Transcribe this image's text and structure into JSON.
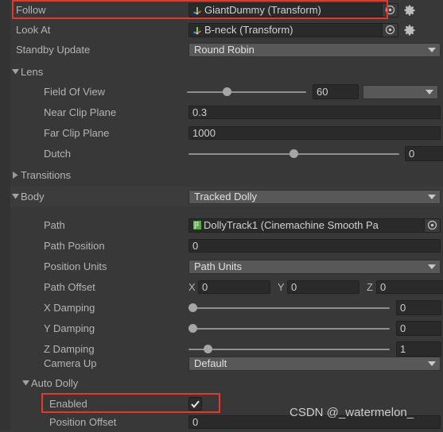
{
  "theme": {
    "bg": "#383838",
    "row_shade": "#3c3c3c",
    "field_bg": "#2a2a2a",
    "dropdown_bg": "#585858",
    "text": "#b4b4b4",
    "highlight": "#e8362a"
  },
  "rows": {
    "follow": {
      "label": "Follow",
      "value": "GiantDummy (Transform)",
      "icon": "transform-axis-icon",
      "picker": "object-picker-icon",
      "gear": "gear-icon"
    },
    "look_at": {
      "label": "Look At",
      "value": "B-neck (Transform)",
      "icon": "transform-axis-icon",
      "picker": "object-picker-icon",
      "gear": "gear-icon"
    },
    "standby_update": {
      "label": "Standby Update",
      "value": "Round Robin"
    },
    "lens": {
      "label": "Lens",
      "expanded": true,
      "field_of_view": {
        "label": "Field Of View",
        "value": "60",
        "slider_pct": 33,
        "mode": ""
      },
      "near_clip_plane": {
        "label": "Near Clip Plane",
        "value": "0.3"
      },
      "far_clip_plane": {
        "label": "Far Clip Plane",
        "value": "1000"
      },
      "dutch": {
        "label": "Dutch",
        "value": "0",
        "slider_pct": 50
      }
    },
    "transitions": {
      "label": "Transitions",
      "expanded": false
    },
    "body": {
      "label": "Body",
      "expanded": true,
      "value": "Tracked Dolly",
      "path": {
        "label": "Path",
        "value": "DollyTrack1 (Cinemachine Smooth Pa",
        "icon": "script-asset-icon",
        "picker": "object-picker-icon"
      },
      "path_position": {
        "label": "Path Position",
        "value": "0"
      },
      "position_units": {
        "label": "Position Units",
        "value": "Path Units"
      },
      "path_offset": {
        "label": "Path Offset",
        "x_label": "X",
        "x": "0",
        "y_label": "Y",
        "y": "0",
        "z_label": "Z",
        "z": "0"
      },
      "x_damping": {
        "label": "X Damping",
        "value": "0",
        "slider_pct": 0
      },
      "y_damping": {
        "label": "Y Damping",
        "value": "0",
        "slider_pct": 0
      },
      "z_damping": {
        "label": "Z Damping",
        "value": "1",
        "slider_pct": 10
      },
      "camera_up": {
        "label": "Camera Up",
        "value": "Default"
      },
      "auto_dolly": {
        "label": "Auto Dolly",
        "expanded": true,
        "enabled": {
          "label": "Enabled",
          "checked": true,
          "check": "checkmark-icon"
        },
        "position_offset": {
          "label": "Position Offset",
          "value": "0"
        }
      }
    }
  },
  "watermark": {
    "text": "CSDN @_watermelon_"
  }
}
